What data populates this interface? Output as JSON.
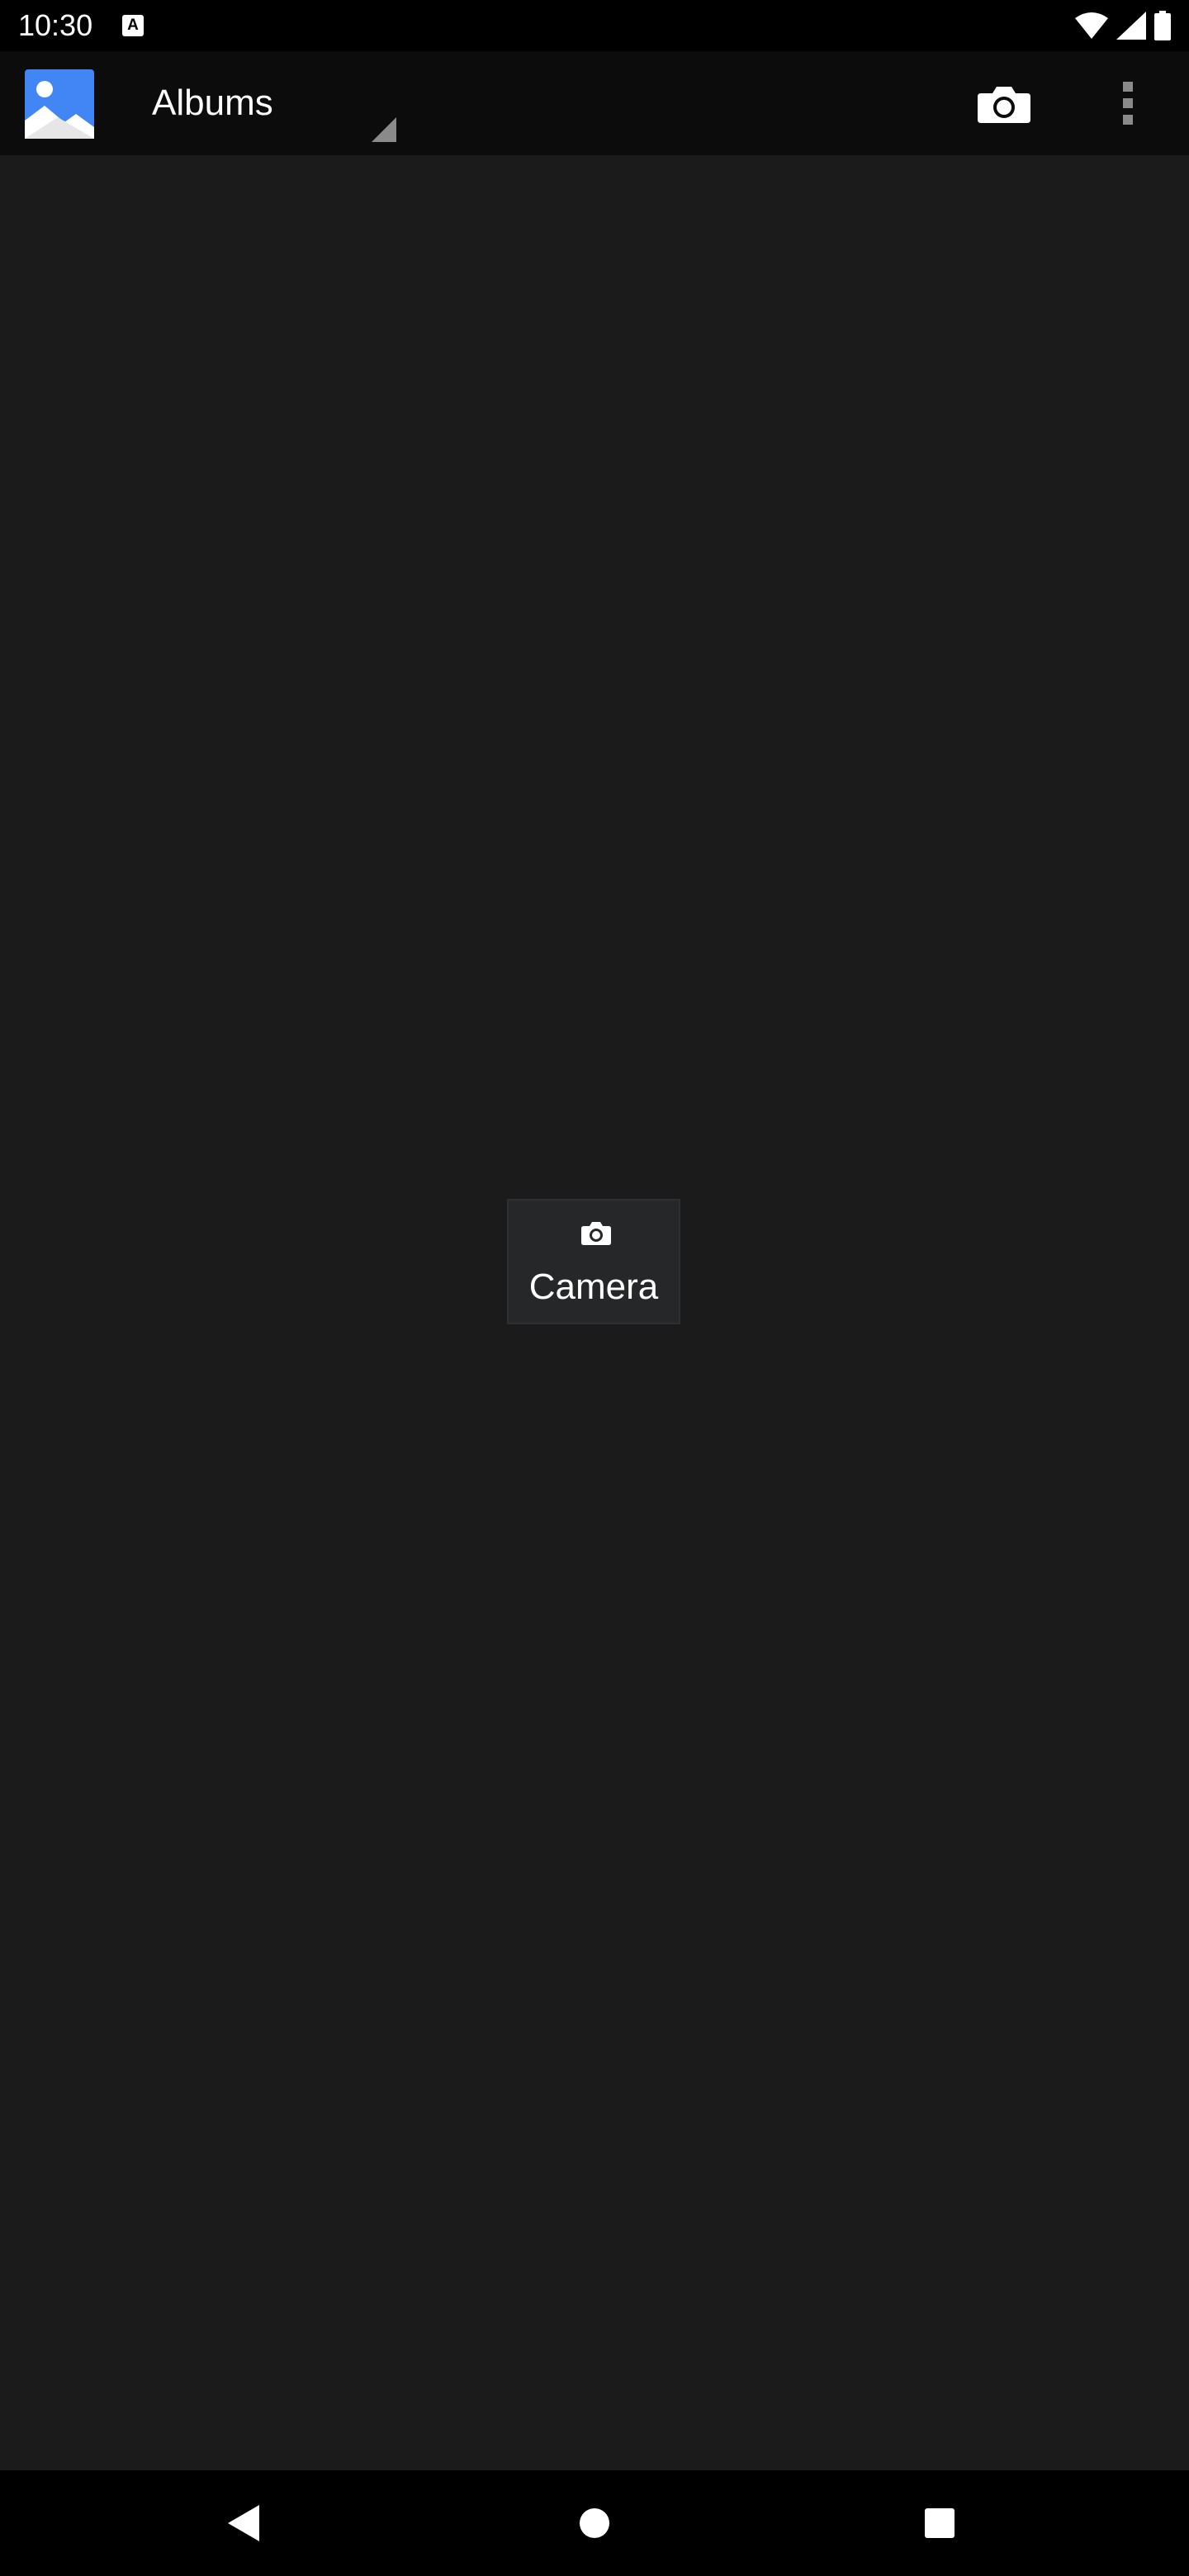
{
  "status_bar": {
    "time": "10:30",
    "notification_icon_letter": "A",
    "icons": [
      "notification-icon",
      "wifi-icon",
      "signal-icon",
      "battery-icon"
    ]
  },
  "app_bar": {
    "app_icon": "gallery-app-icon",
    "spinner_title": "Albums",
    "actions": [
      "camera-icon",
      "overflow-menu-icon"
    ]
  },
  "albums": [
    {
      "label": "Camera",
      "icon": "camera-icon"
    }
  ],
  "nav_bar": {
    "buttons": [
      "back-icon",
      "home-icon",
      "recents-icon"
    ]
  },
  "colors": {
    "background": "#1b1b1b",
    "app_bar": "#0c0c0c",
    "album_tile": "#262729",
    "accent_blue": "#4285f4"
  }
}
